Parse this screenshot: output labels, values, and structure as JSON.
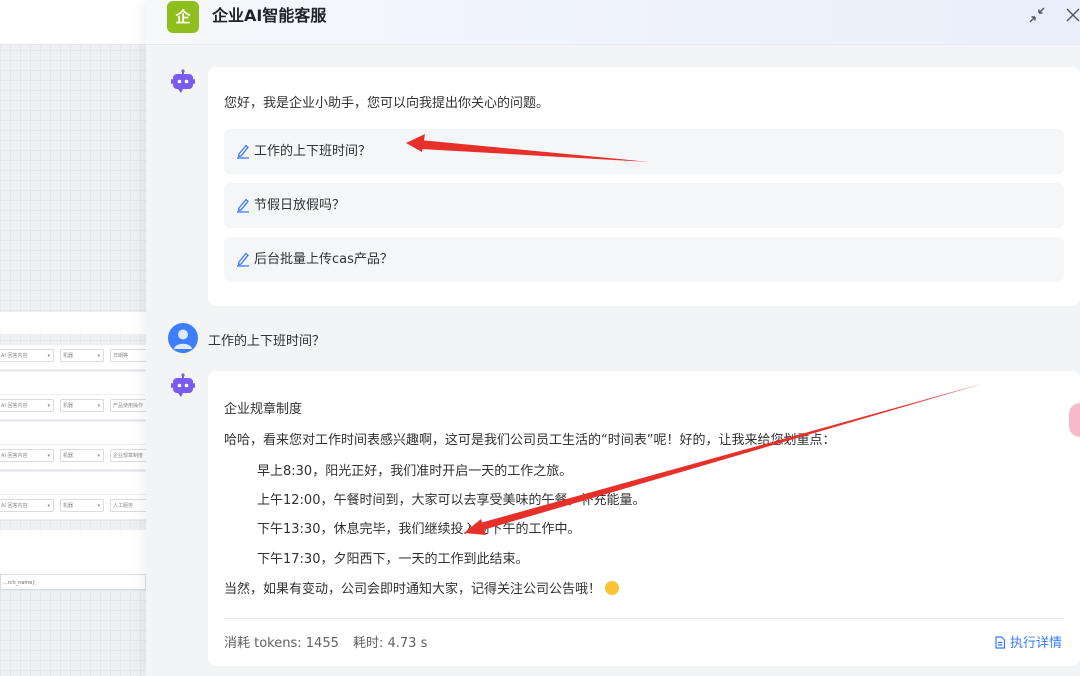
{
  "background": {
    "rows": [
      {
        "col1": "AI 回答内容",
        "col2": "机器",
        "col3": "日期等"
      },
      {
        "col1": "AI 回答内容",
        "col2": "机器",
        "col3": "产品使用操作"
      },
      {
        "col1": "AI 回答内容",
        "col2": "机器",
        "col3": "企业规章制度"
      },
      {
        "col1": "AI 回答内容",
        "col2": "机器",
        "col3": "人工服务"
      }
    ],
    "input_value": "...rch_name}"
  },
  "header": {
    "logo_text": "企",
    "title": "企业AI智能客服"
  },
  "welcome": {
    "greeting": "您好，我是企业小助手，您可以向我提出你关心的问题。",
    "suggestions": [
      {
        "label": "工作的上下班时间？"
      },
      {
        "label": "节假日放假吗？"
      },
      {
        "label": "后台批量上传cas产品？"
      }
    ]
  },
  "user_message": "工作的上下班时间？",
  "answer": {
    "category": "企业规章制度",
    "intro": "哈哈，看来您对工作时间表感兴趣啊，这可是我们公司员工生活的“时间表”呢！好的，让我来给您划重点：",
    "schedule": [
      "早上8:30，阳光正好，我们准时开启一天的工作之旅。",
      "上午12:00，午餐时间到，大家可以去享受美味的午餐，补充能量。",
      "下午13:30，休息完毕，我们继续投入到下午的工作中。",
      "下午17:30，夕阳西下，一天的工作到此结束。"
    ],
    "closing": "当然，如果有变动，公司会即时通知大家，记得关注公司公告哦！",
    "tokens": "消耗 tokens: 1455",
    "time": "耗时: 4.73 s",
    "detail_link": "执行详情"
  },
  "colors": {
    "accent": "#3a7afe",
    "logo": "#8fbf1d",
    "bot_icon": "#7b5cf0",
    "annotation": "#e8302a"
  }
}
